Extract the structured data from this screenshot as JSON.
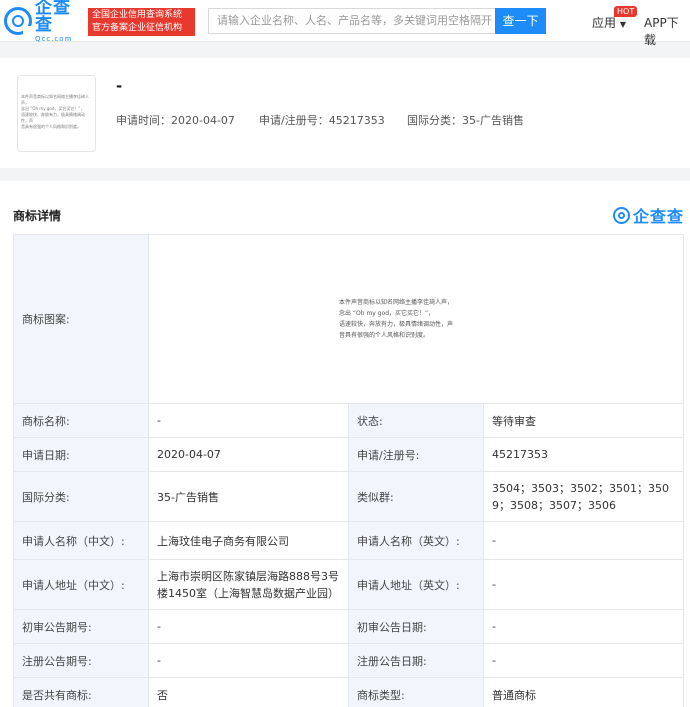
{
  "header": {
    "logo_cn": "企查查",
    "logo_en": "Qcc.com",
    "badge_line1": "全国企业信用查询系统",
    "badge_line2": "官方备案企业征信机构",
    "search_placeholder": "请输入企业名称、人名、产品名等，多关键词用空格隔开",
    "search_button": "查一下",
    "apps": "应用",
    "hot": "HOT",
    "app_download": "APP下载"
  },
  "summary": {
    "title": "-",
    "apply_time_label": "申请时间：",
    "apply_time": "2020-04-07",
    "reg_no_label": "申请/注册号：",
    "reg_no": "45217353",
    "class_label": "国际分类：",
    "class": "35-广告销售",
    "thumb_lines": [
      "本件声音商标以知名网络主播李佳琦人声，",
      "念出 “Oh my god，买它买它！”，",
      "语速较快，奔放有力，极具情绪调动性，声",
      "音具有很强的个人风格和识别度。"
    ]
  },
  "details": {
    "title": "商标详情",
    "brand": "企查查",
    "image_label": "商标图案:",
    "image_text": [
      "本件声音商标以知名网络主播李佳琦人声，",
      "念出 “Oh my god，买它买它！”，",
      "语速较快，奔放有力，极具情绪调动性，声",
      "音具有很强的个人风格和识别度。"
    ],
    "rows": [
      {
        "l1": "商标名称:",
        "v1": "-",
        "l2": "状态:",
        "v2": "等待审查"
      },
      {
        "l1": "申请日期:",
        "v1": "2020-04-07",
        "l2": "申请/注册号:",
        "v2": "45217353"
      },
      {
        "l1": "国际分类:",
        "v1": "35-广告销售",
        "l2": "类似群:",
        "v2": "3504；3503；3502；3501；3509；3508；3507；3506"
      },
      {
        "l1": "申请人名称（中文）:",
        "v1": "上海玟佳电子商务有限公司",
        "l2": "申请人名称（英文）:",
        "v2": "-"
      },
      {
        "l1": "申请人地址（中文）:",
        "v1": "上海市崇明区陈家镇层海路888号3号楼1450室（上海智慧岛数据产业园）",
        "l2": "申请人地址（英文）:",
        "v2": "-"
      },
      {
        "l1": "初审公告期号:",
        "v1": "-",
        "l2": "初审公告日期:",
        "v2": "-"
      },
      {
        "l1": "注册公告期号:",
        "v1": "-",
        "l2": "注册公告日期:",
        "v2": "-"
      },
      {
        "l1": "是否共有商标:",
        "v1": "否",
        "l2": "商标类型:",
        "v2": "普通商标"
      }
    ]
  }
}
